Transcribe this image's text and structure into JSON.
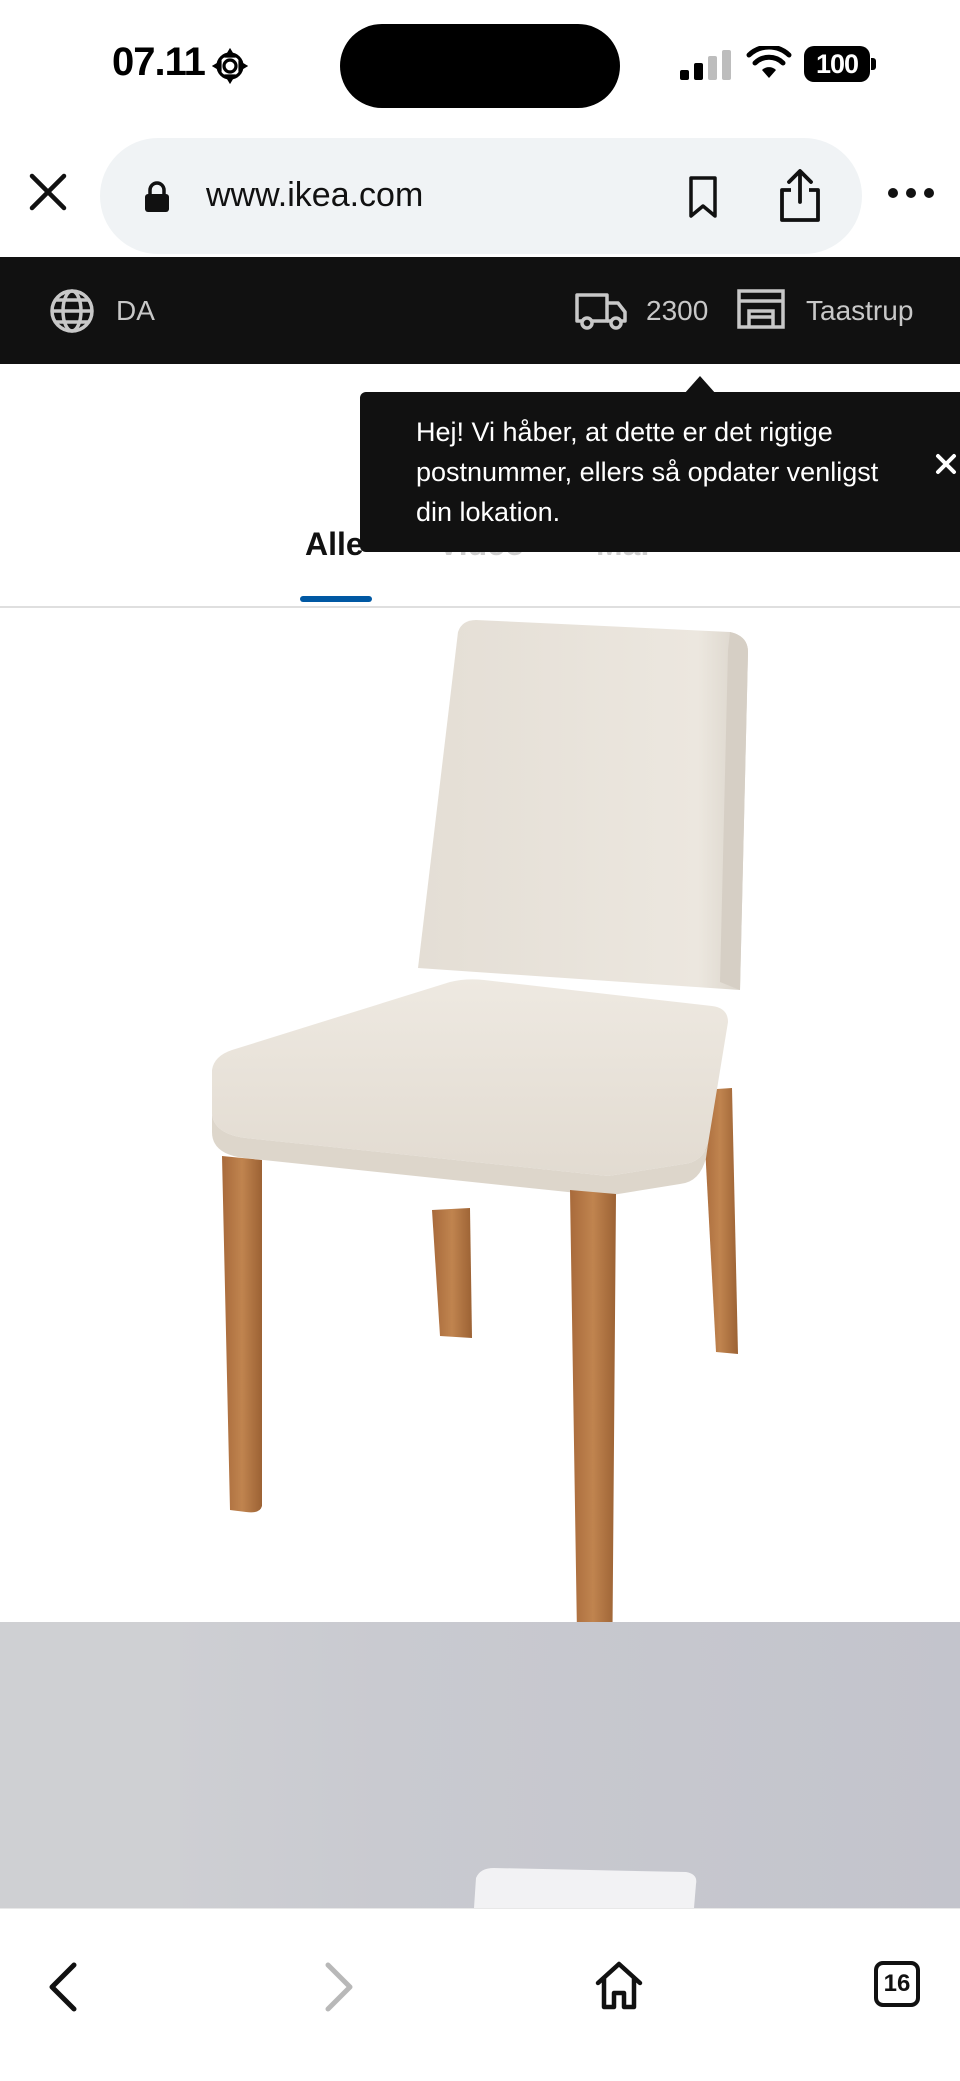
{
  "status_bar": {
    "time": "07.11",
    "battery": "100"
  },
  "browser": {
    "url": "www.ikea.com"
  },
  "ikea_bar": {
    "language": "DA",
    "postcode": "2300",
    "store": "Taastrup"
  },
  "tooltip": {
    "text": "Hej! Vi håber, at dette er det rigtige postnummer, ellers så opdater venligst din lokation."
  },
  "media_tabs": [
    {
      "label": "Alle",
      "active": true
    },
    {
      "label": "Video",
      "active": false
    },
    {
      "label": "Mål",
      "active": false
    }
  ],
  "toolbar": {
    "tab_count": "16"
  },
  "colors": {
    "ikea_bar_bg": "#111111",
    "active_tab_underline": "#0058a3",
    "chair_fabric": "#e7e1d8",
    "chair_legs": "#b97a4a"
  },
  "icons": [
    "settings-icon",
    "signal-icon",
    "wifi-icon",
    "battery-icon",
    "close-icon",
    "lock-icon",
    "bookmark-icon",
    "share-icon",
    "more-icon",
    "globe-icon",
    "truck-icon",
    "store-icon",
    "back-icon",
    "forward-icon",
    "home-icon",
    "tabs-icon"
  ]
}
